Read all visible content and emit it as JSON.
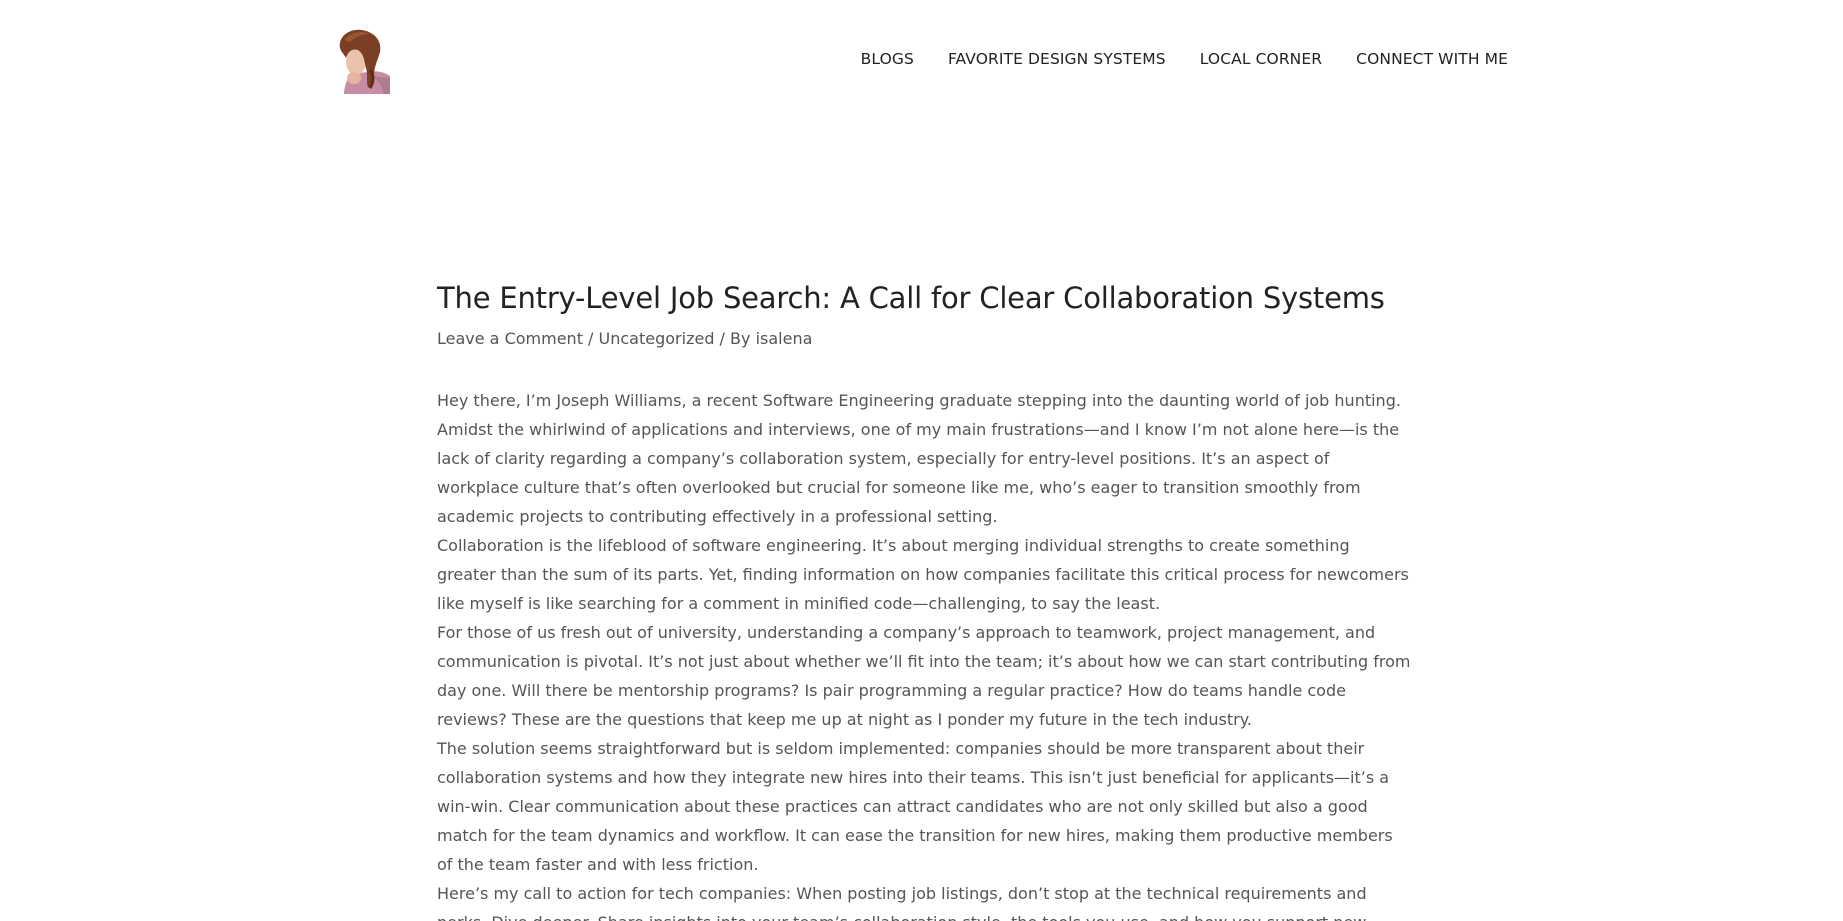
{
  "header": {
    "logo_name": "avatar",
    "nav": [
      {
        "label": "BLOGS"
      },
      {
        "label": "FAVORITE DESIGN SYSTEMS"
      },
      {
        "label": "LOCAL CORNER"
      },
      {
        "label": "CONNECT WITH ME"
      }
    ]
  },
  "post": {
    "title": "The Entry-Level Job Search: A Call for Clear Collaboration Systems",
    "meta": {
      "comment_link": "Leave a Comment",
      "sep1": " / ",
      "category": "Uncategorized",
      "sep2": " / By ",
      "author": "isalena"
    },
    "paragraphs": [
      "Hey there, I’m Joseph Williams, a recent Software Engineering graduate stepping into the daunting world of job hunting. Amidst the whirlwind of applications and interviews, one of my main frustrations—and I know I’m not alone here—is the lack of clarity regarding a company’s collaboration system, especially for entry-level positions. It’s an aspect of workplace culture that’s often overlooked but crucial for someone like me, who’s eager to transition smoothly from academic projects to contributing effectively in a professional setting.",
      "Collaboration is the lifeblood of software engineering. It’s about merging individual strengths to create something greater than the sum of its parts. Yet, finding information on how companies facilitate this critical process for newcomers like myself is like searching for a comment in minified code—challenging, to say the least.",
      "For those of us fresh out of university, understanding a company’s approach to teamwork, project management, and communication is pivotal. It’s not just about whether we’ll fit into the team; it’s about how we can start contributing from day one. Will there be mentorship programs? Is pair programming a regular practice? How do teams handle code reviews? These are the questions that keep me up at night as I ponder my future in the tech industry.",
      "The solution seems straightforward but is seldom implemented: companies should be more transparent about their collaboration systems and how they integrate new hires into their teams. This isn’t just beneficial for applicants—it’s a win-win. Clear communication about these practices can attract candidates who are not only skilled but also a good match for the team dynamics and workflow. It can ease the transition for new hires, making them productive members of the team faster and with less friction.",
      "Here’s my call to action for tech companies: When posting job listings, don’t stop at the technical requirements and perks. Dive deeper. Share insights into your team’s collaboration style, the tools you use, and how you support new engineers. This"
    ]
  }
}
